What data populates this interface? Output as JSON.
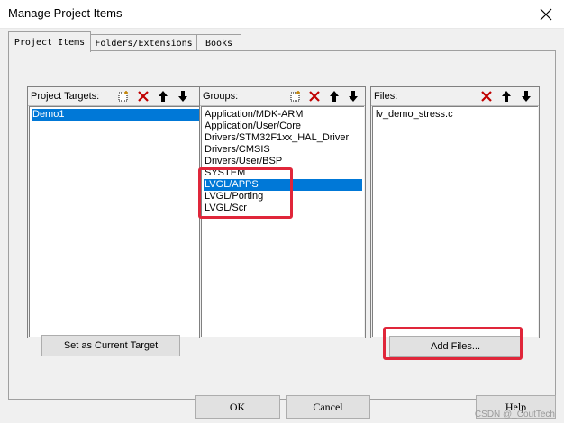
{
  "window": {
    "title": "Manage Project Items"
  },
  "tabs": [
    {
      "label": "Project Items",
      "active": true
    },
    {
      "label": "Folders/Extensions",
      "active": false
    },
    {
      "label": "Books",
      "active": false
    }
  ],
  "targets": {
    "label": "Project Targets:",
    "items": [
      "Demo1"
    ],
    "selected_index": 0
  },
  "groups": {
    "label": "Groups:",
    "items": [
      "Application/MDK-ARM",
      "Application/User/Core",
      "Drivers/STM32F1xx_HAL_Driver",
      "Drivers/CMSIS",
      "Drivers/User/BSP",
      "SYSTEM",
      "LVGL/APPS",
      "LVGL/Porting",
      "LVGL/Scr"
    ],
    "selected_index": 6
  },
  "files": {
    "label": "Files:",
    "items": [
      "lv_demo_stress.c"
    ]
  },
  "buttons": {
    "set_current_target": "Set as Current Target",
    "add_files": "Add Files...",
    "ok": "OK",
    "cancel": "Cancel",
    "help": "Help"
  },
  "watermark": "CSDN @_CoutTech",
  "colors": {
    "selection": "#0078d7",
    "highlight_box": "#e0263a"
  }
}
